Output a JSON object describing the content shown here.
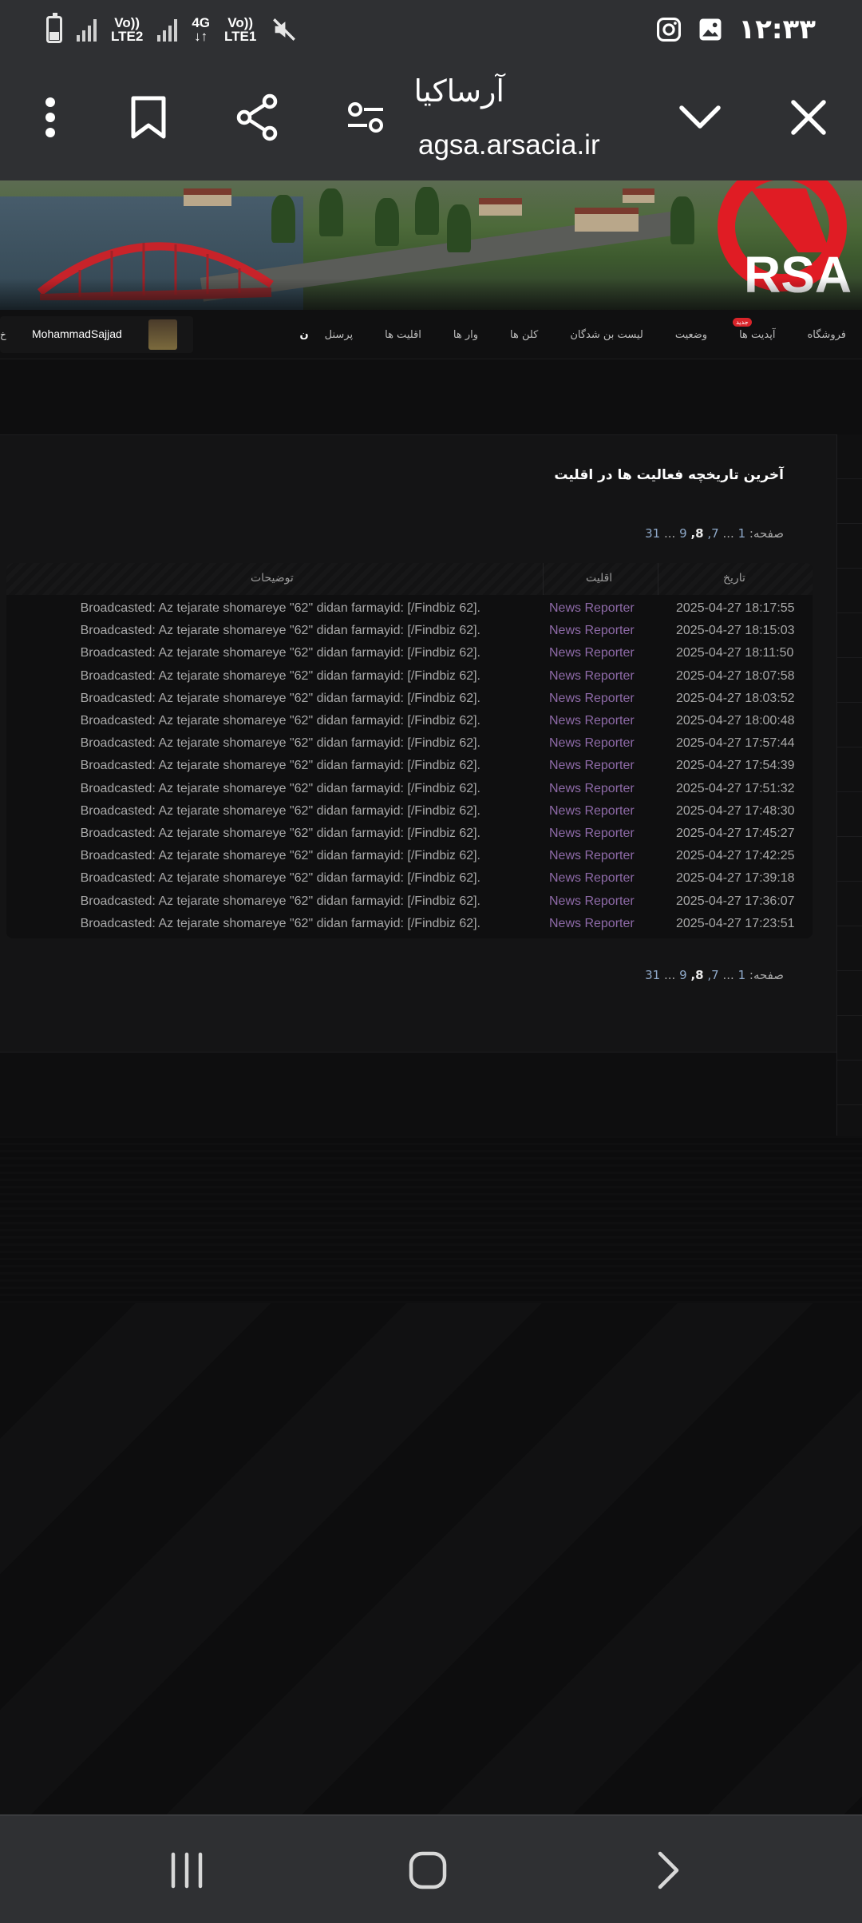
{
  "status_bar": {
    "time": "۱۲:۳۳",
    "network1_top": "Vo))",
    "network1_bottom": "LTE2",
    "network2_top": "4G",
    "network2_bottom": "↓↑",
    "network3_top": "Vo))",
    "network3_bottom": "LTE1",
    "battery_level": 0.35
  },
  "browser": {
    "title": "آرساکیا",
    "url": "agsa.arsacia.ir"
  },
  "site_nav": {
    "items": [
      "پرسنل",
      "اقلیت ها",
      "وار ها",
      "کلن ها",
      "لیست بن شدگان",
      "وضعیت",
      "آپدیت ها",
      "فروشگاه"
    ],
    "first_item_fragment": "ن",
    "update_badge": "جدید",
    "username": "MohammadSajjad",
    "left_edge_fragment": "خ"
  },
  "main": {
    "section_title": "آخرین تاریخچه فعالیت ها در اقلیت",
    "pager_label": "صفحه:",
    "pager_pages": [
      "1",
      "...",
      "7,",
      "8,",
      "9",
      "...",
      "31"
    ],
    "pager_current": "8,",
    "table": {
      "headers": {
        "date": "تاریخ",
        "category": "اقلیت",
        "description": "توضیحات"
      },
      "rows": [
        {
          "date": "2025-04-27 18:17:55",
          "category": "News Reporter",
          "description": "Broadcasted: Az tejarate shomareye \"62\" didan farmayid: [/Findbiz 62]."
        },
        {
          "date": "2025-04-27 18:15:03",
          "category": "News Reporter",
          "description": "Broadcasted: Az tejarate shomareye \"62\" didan farmayid: [/Findbiz 62]."
        },
        {
          "date": "2025-04-27 18:11:50",
          "category": "News Reporter",
          "description": "Broadcasted: Az tejarate shomareye \"62\" didan farmayid: [/Findbiz 62]."
        },
        {
          "date": "2025-04-27 18:07:58",
          "category": "News Reporter",
          "description": "Broadcasted: Az tejarate shomareye \"62\" didan farmayid: [/Findbiz 62]."
        },
        {
          "date": "2025-04-27 18:03:52",
          "category": "News Reporter",
          "description": "Broadcasted: Az tejarate shomareye \"62\" didan farmayid: [/Findbiz 62]."
        },
        {
          "date": "2025-04-27 18:00:48",
          "category": "News Reporter",
          "description": "Broadcasted: Az tejarate shomareye \"62\" didan farmayid: [/Findbiz 62]."
        },
        {
          "date": "2025-04-27 17:57:44",
          "category": "News Reporter",
          "description": "Broadcasted: Az tejarate shomareye \"62\" didan farmayid: [/Findbiz 62]."
        },
        {
          "date": "2025-04-27 17:54:39",
          "category": "News Reporter",
          "description": "Broadcasted: Az tejarate shomareye \"62\" didan farmayid: [/Findbiz 62]."
        },
        {
          "date": "2025-04-27 17:51:32",
          "category": "News Reporter",
          "description": "Broadcasted: Az tejarate shomareye \"62\" didan farmayid: [/Findbiz 62]."
        },
        {
          "date": "2025-04-27 17:48:30",
          "category": "News Reporter",
          "description": "Broadcasted: Az tejarate shomareye \"62\" didan farmayid: [/Findbiz 62]."
        },
        {
          "date": "2025-04-27 17:45:27",
          "category": "News Reporter",
          "description": "Broadcasted: Az tejarate shomareye \"62\" didan farmayid: [/Findbiz 62]."
        },
        {
          "date": "2025-04-27 17:42:25",
          "category": "News Reporter",
          "description": "Broadcasted: Az tejarate shomareye \"62\" didan farmayid: [/Findbiz 62]."
        },
        {
          "date": "2025-04-27 17:39:18",
          "category": "News Reporter",
          "description": "Broadcasted: Az tejarate shomareye \"62\" didan farmayid: [/Findbiz 62]."
        },
        {
          "date": "2025-04-27 17:36:07",
          "category": "News Reporter",
          "description": "Broadcasted: Az tejarate shomareye \"62\" didan farmayid: [/Findbiz 62]."
        },
        {
          "date": "2025-04-27 17:23:51",
          "category": "News Reporter",
          "description": "Broadcasted: Az tejarate shomareye \"62\" didan farmayid: [/Findbiz 62]."
        }
      ]
    }
  },
  "logo_text": "RSA",
  "colors": {
    "chrome": "#2f3033",
    "accent_red": "#e01c24",
    "category_purple": "#8e6aa8"
  },
  "icons": {
    "header": [
      "more-vert-icon",
      "bookmark-icon",
      "share-icon",
      "tune-icon",
      "chevron-down-icon",
      "close-icon"
    ],
    "status": [
      "battery-icon",
      "signal-icon",
      "mute-icon",
      "instagram-icon",
      "gallery-icon"
    ],
    "nav": [
      "recents-icon",
      "home-icon",
      "back-icon"
    ]
  }
}
